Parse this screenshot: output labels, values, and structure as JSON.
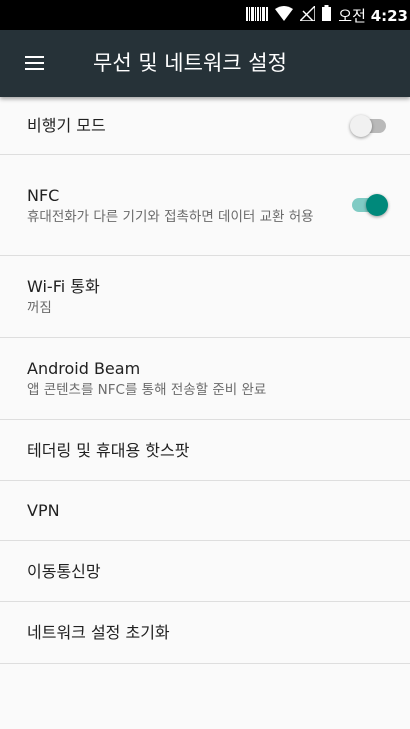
{
  "status_bar": {
    "time_prefix": "오전",
    "time": "4:23",
    "icons": [
      "barcode-icon",
      "wifi-icon",
      "signal-icon",
      "battery-icon"
    ]
  },
  "toolbar": {
    "title": "무선 및 네트워크 설정",
    "menu_icon": "hamburger-menu-icon",
    "background": "#263238"
  },
  "accent_color": "#00897b",
  "settings": {
    "airplane_mode": {
      "title": "비행기 모드",
      "enabled": false
    },
    "nfc": {
      "title": "NFC",
      "summary": "휴대전화가 다른 기기와 접촉하면 데이터 교환 허용",
      "enabled": true
    },
    "wifi_calling": {
      "title": "Wi-Fi 통화",
      "summary": "꺼짐"
    },
    "android_beam": {
      "title": "Android Beam",
      "summary": "앱 콘텐츠를 NFC를 통해 전송할 준비 완료"
    },
    "tethering": {
      "title": "테더링 및 휴대용 핫스팟"
    },
    "vpn": {
      "title": "VPN"
    },
    "mobile_network": {
      "title": "이동통신망"
    },
    "network_reset": {
      "title": "네트워크 설정 초기화"
    }
  }
}
